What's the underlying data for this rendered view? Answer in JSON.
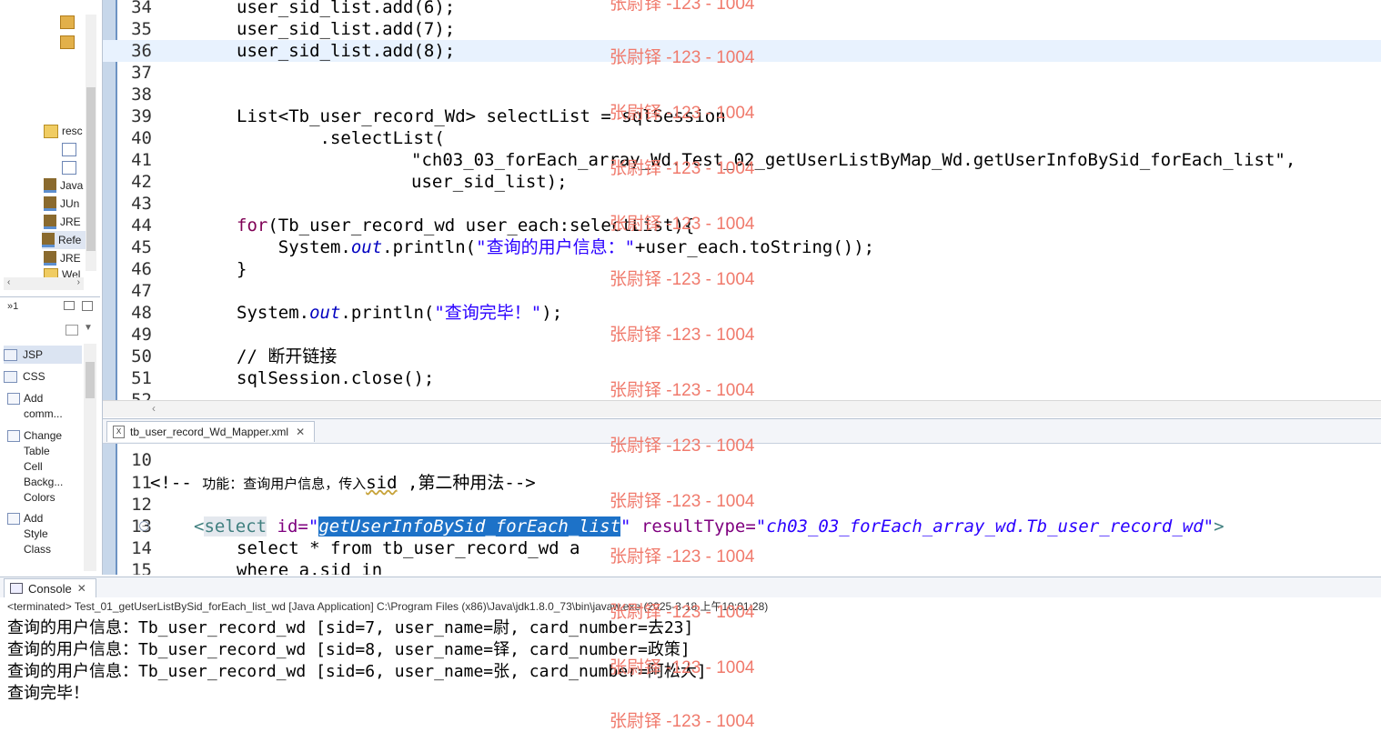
{
  "left_panel": {
    "tree_items": [
      "resc",
      "Java",
      "JUn",
      "JRE",
      "Refe",
      "JRE",
      "Wel"
    ],
    "view_menu_label": "»1",
    "palette_categories": [
      "JSP",
      "CSS"
    ],
    "palette_items": [
      [
        "Add",
        "comm..."
      ],
      [
        "Change",
        "Table",
        "Cell",
        "Backg...",
        "Colors"
      ],
      [
        "Add",
        "Style",
        "Class"
      ]
    ]
  },
  "java_editor": {
    "lines": [
      {
        "n": "34",
        "code": "user_sid_list.add(6);"
      },
      {
        "n": "35",
        "code": "user_sid_list.add(7);"
      },
      {
        "n": "36",
        "code": "user_sid_list.add(8);"
      },
      {
        "n": "37",
        "code": ""
      },
      {
        "n": "38",
        "code": ""
      },
      {
        "n": "39",
        "code": "List<Tb_user_record_Wd> selectList = sqlSession"
      },
      {
        "n": "40",
        "code": "        .selectList("
      },
      {
        "n": "41",
        "code": "\"ch03_03_forEach_array_Wd.Test_02_getUserListByMap_Wd.getUserInfoBySid_forEach_list\","
      },
      {
        "n": "42",
        "code": "user_sid_list);"
      },
      {
        "n": "43",
        "code": ""
      },
      {
        "n": "44",
        "kw": "for",
        "code": "(Tb_user_record_wd user_each:selectList){"
      },
      {
        "n": "45",
        "pre": "    System.",
        "field": "out",
        "mid": ".println(",
        "str": "\"查询的用户信息：\"",
        "post": "+user_each.toString());"
      },
      {
        "n": "46",
        "code": "}"
      },
      {
        "n": "47",
        "code": ""
      },
      {
        "n": "48",
        "pre": "System.",
        "field": "out",
        "mid": ".println(",
        "str": "\"查询完毕！\"",
        "post": ");"
      },
      {
        "n": "49",
        "code": ""
      },
      {
        "n": "50",
        "comment": "// 断开链接"
      },
      {
        "n": "51",
        "code": "sqlSession.close();"
      }
    ],
    "partial_line_number": "52"
  },
  "xml_editor": {
    "tab_label": "tb_user_record_Wd_Mapper.xml",
    "line_10": "10",
    "line_11": {
      "n": "11",
      "comment_open": "<!-- ",
      "comment_text": "功能：查询用户信息，传入",
      "sid": "sid",
      "comment_rest": " ,第二种用法-->"
    },
    "line_12": "12",
    "line_13": {
      "n": "13",
      "open": "<",
      "tag": "select",
      "attr1": " id=",
      "q1": "\"",
      "id_value": "getUserInfoBySid_forEach_list",
      "q2": "\"",
      "attr2": " resultType=",
      "result_value": "\"ch03_03_forEach_array_wd.Tb_user_record_wd\"",
      "close": ">"
    },
    "line_14": {
      "n": "14",
      "code": "select * from tb_user_record_wd a"
    },
    "line_15": {
      "n": "15",
      "code": "where a.sid in"
    }
  },
  "console": {
    "tab_label": "Console",
    "status": "<terminated> Test_01_getUserListBySid_forEach_list_wd [Java Application] C:\\Program Files (x86)\\Java\\jdk1.8.0_73\\bin\\javaw.exe (2025-3-18 上午10:01:28)",
    "output": [
      "查询的用户信息：Tb_user_record_wd [sid=7, user_name=尉, card_number=去23]",
      "查询的用户信息：Tb_user_record_wd [sid=8, user_name=铎, card_number=政策]",
      "查询的用户信息：Tb_user_record_wd [sid=6, user_name=张, card_number=阿松大]",
      "查询完毕！"
    ]
  },
  "watermark": "张尉铎 -123 - 1004",
  "colors": {
    "keyword": "#7f0055",
    "string": "#2a00ff",
    "comment": "#3f7f5f",
    "selection": "#1d72c8",
    "watermark": "#f07a6c"
  }
}
